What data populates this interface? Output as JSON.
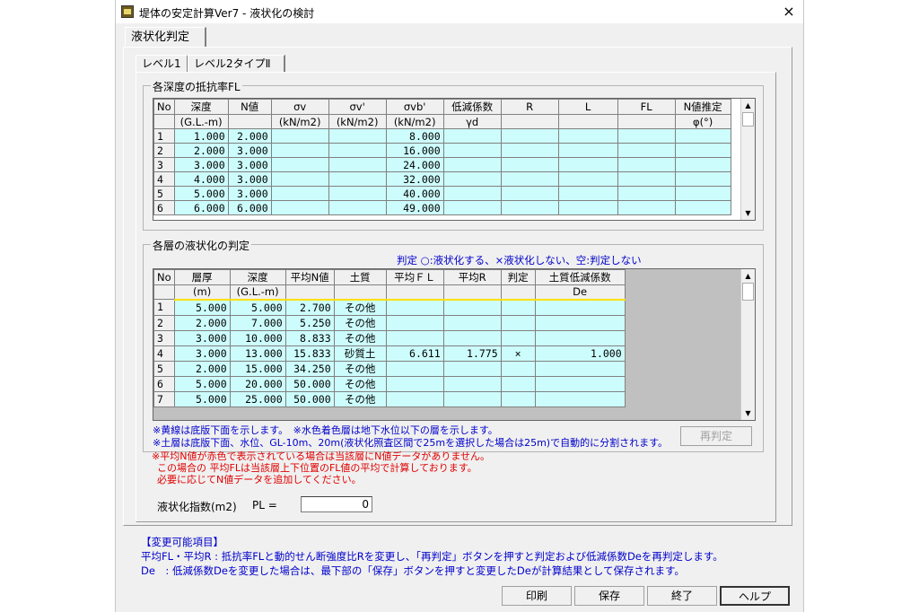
{
  "window": {
    "title": "堤体の安定計算Ver7 - 液状化の検討",
    "close": "×"
  },
  "tabs": [
    {
      "label": "液状化判定"
    }
  ],
  "subtabs": [
    {
      "label": "レベル1"
    },
    {
      "label": "レベル2タイプⅡ"
    }
  ],
  "fl_group": {
    "title": "各深度の抵抗率FL",
    "headers1": [
      "No",
      "深度",
      "N値",
      "σv",
      "σv'",
      "σvb'",
      "低減係数",
      "R",
      "L",
      "FL",
      "N値推定"
    ],
    "headers2": [
      "",
      "(G.L.-m)",
      "",
      "(kN/m2)",
      "(kN/m2)",
      "(kN/m2)",
      "γd",
      "",
      "",
      "",
      "φ(°)"
    ],
    "rows": [
      {
        "no": "1",
        "depth": "1.000",
        "n": "2.000",
        "svb": "8.000"
      },
      {
        "no": "2",
        "depth": "2.000",
        "n": "3.000",
        "svb": "16.000"
      },
      {
        "no": "3",
        "depth": "3.000",
        "n": "3.000",
        "svb": "24.000"
      },
      {
        "no": "4",
        "depth": "4.000",
        "n": "3.000",
        "svb": "32.000"
      },
      {
        "no": "5",
        "depth": "5.000",
        "n": "3.000",
        "svb": "40.000"
      },
      {
        "no": "6",
        "depth": "6.000",
        "n": "6.000",
        "svb": "49.000"
      }
    ]
  },
  "liq_group": {
    "title": "各層の液状化の判定",
    "legend": "判定 ○:液状化する、×液状化しない、空:判定しない",
    "headers1": [
      "No",
      "層厚",
      "深度",
      "平均N値",
      "土質",
      "平均ＦＬ",
      "平均R",
      "判定",
      "土質低減係数"
    ],
    "headers2": [
      "",
      "(m)",
      "(G.L.-m)",
      "",
      "",
      "",
      "",
      "",
      "De"
    ],
    "rows": [
      {
        "no": "1",
        "thick": "5.000",
        "depth": "5.000",
        "n": "2.700",
        "soil": "その他",
        "fl": "",
        "r": "",
        "judge": "",
        "de": ""
      },
      {
        "no": "2",
        "thick": "2.000",
        "depth": "7.000",
        "n": "5.250",
        "soil": "その他",
        "fl": "",
        "r": "",
        "judge": "",
        "de": ""
      },
      {
        "no": "3",
        "thick": "3.000",
        "depth": "10.000",
        "n": "8.833",
        "soil": "その他",
        "fl": "",
        "r": "",
        "judge": "",
        "de": ""
      },
      {
        "no": "4",
        "thick": "3.000",
        "depth": "13.000",
        "n": "15.833",
        "soil": "砂質土",
        "fl": "6.611",
        "r": "1.775",
        "judge": "×",
        "de": "1.000"
      },
      {
        "no": "5",
        "thick": "2.000",
        "depth": "15.000",
        "n": "34.250",
        "soil": "その他",
        "fl": "",
        "r": "",
        "judge": "",
        "de": ""
      },
      {
        "no": "6",
        "thick": "5.000",
        "depth": "20.000",
        "n": "50.000",
        "soil": "その他",
        "fl": "",
        "r": "",
        "judge": "",
        "de": ""
      },
      {
        "no": "7",
        "thick": "5.000",
        "depth": "25.000",
        "n": "50.000",
        "soil": "その他",
        "fl": "",
        "r": "",
        "judge": "",
        "de": ""
      }
    ],
    "notes_blue": [
      "※黄線は底版下面を示します。　※水色着色層は地下水位以下の層を示します。",
      "※土層は底版下面、水位、GL-10m、20m(液状化照査区間で25mを選択した場合は25m)で自動的に分割されます。"
    ],
    "notes_red": [
      "※平均N値が赤色で表示されている場合は当該層にN値データがありません。",
      "この場合の 平均FLは当該層上下位置のFL値の平均で計算しております。",
      "必要に応じてN値データを追加してください。"
    ],
    "rejudge_button": "再判定"
  },
  "pl": {
    "label": "液状化指数(m2)",
    "sublabel": "PL =",
    "value": "0"
  },
  "info": {
    "title": "【変更可能項目】",
    "lines": [
      "平均FL・平均R : 抵抗率FLと動的せん断強度比Rを変更し、「再判定」ボタンを押すと判定および低減係数Deを再判定します。",
      "De　: 低減係数Deを変更した場合は、最下部の「保存」ボタンを押すと変更したDeが計算結果として保存されます。"
    ]
  },
  "buttons": {
    "print": "印刷",
    "save": "保存",
    "exit": "終了",
    "help": "ヘルプ"
  },
  "colors": {
    "water_cell": "#cdfcfc",
    "note_blue": "#0000cc",
    "note_red": "#e00000",
    "base_line": "#ffe000"
  }
}
